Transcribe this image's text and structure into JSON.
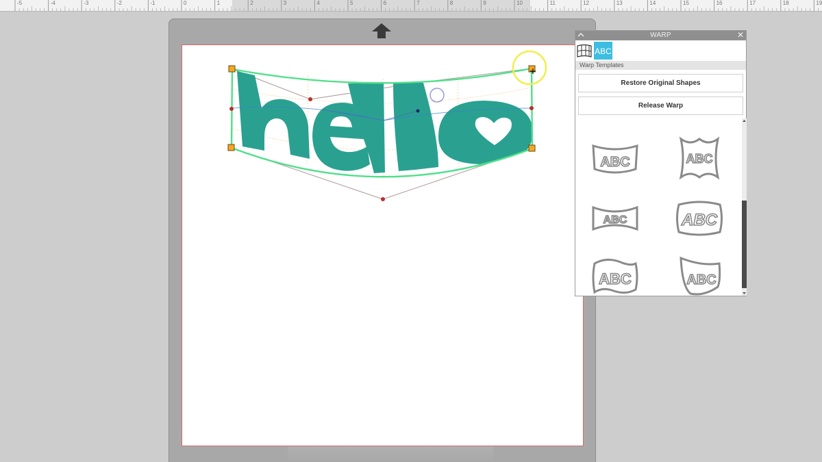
{
  "ruler": {
    "ticks": [
      {
        "label": "-5",
        "value": -5
      },
      {
        "label": "-4",
        "value": -4
      },
      {
        "label": "-3",
        "value": -3
      },
      {
        "label": "-2",
        "value": -2
      },
      {
        "label": "-1",
        "value": -1
      },
      {
        "label": "0",
        "value": 0
      },
      {
        "label": "1",
        "value": 1
      },
      {
        "label": "2",
        "value": 2
      },
      {
        "label": "3",
        "value": 3
      },
      {
        "label": "4",
        "value": 4
      },
      {
        "label": "5",
        "value": 5
      },
      {
        "label": "6",
        "value": 6
      },
      {
        "label": "7",
        "value": 7
      },
      {
        "label": "8",
        "value": 8
      },
      {
        "label": "9",
        "value": 9
      },
      {
        "label": "10",
        "value": 10
      },
      {
        "label": "11",
        "value": 11
      },
      {
        "label": "12",
        "value": 12
      },
      {
        "label": "13",
        "value": 13
      },
      {
        "label": "14",
        "value": 14
      },
      {
        "label": "15",
        "value": 15
      },
      {
        "label": "16",
        "value": 16
      },
      {
        "label": "17",
        "value": 17
      },
      {
        "label": "18",
        "value": 18
      },
      {
        "label": "19",
        "value": 19
      }
    ]
  },
  "canvas": {
    "text": "hello",
    "text_color": "#2aa190",
    "warp_outline_color": "#4fe08a",
    "handle_color": "#f5a623",
    "cursor_highlight_color": "#f2ee4a",
    "load_arrow_icon": "arrow-up-icon"
  },
  "warp_panel": {
    "title": "WARP",
    "collapse_icon": "chevron-up-icon",
    "close_glyph": "✕",
    "tabs": [
      {
        "icon": "mesh-warp-icon",
        "active": false
      },
      {
        "icon": "abc-template-icon",
        "active": true,
        "label": "ABC"
      }
    ],
    "section_label": "Warp Templates",
    "restore_button": "Restore Original Shapes",
    "release_button": "Release Warp",
    "templates": [
      {
        "label": "ABC",
        "shape": "arc-up"
      },
      {
        "label": "ABC",
        "shape": "bulge-wave"
      },
      {
        "label": "ABC",
        "shape": "pinch"
      },
      {
        "label": "ABC",
        "shape": "inflate"
      },
      {
        "label": "ABC",
        "shape": "flag"
      },
      {
        "label": "ABC",
        "shape": "shield"
      }
    ],
    "accent_color": "#3dbde0"
  }
}
